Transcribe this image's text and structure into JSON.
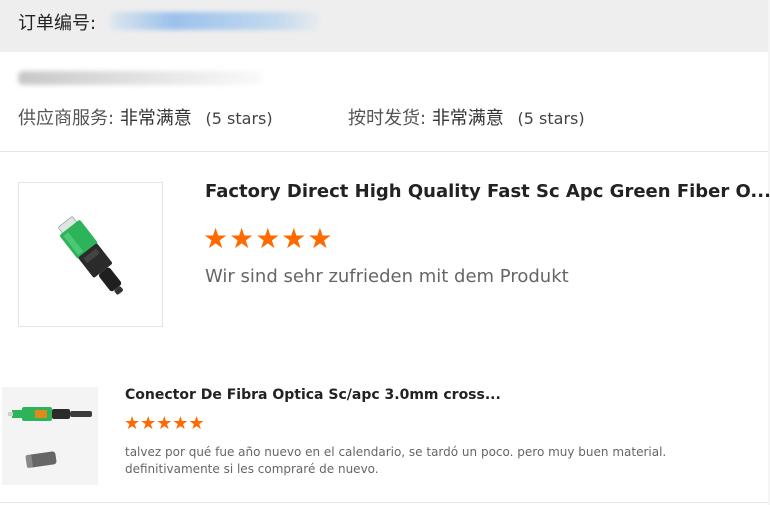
{
  "order": {
    "label": "订单编号:",
    "number_masked": true
  },
  "buyer": {
    "name_masked": true
  },
  "store_ratings": [
    {
      "label": "供应商服务:",
      "value": "非常满意",
      "stars": "(5 stars)"
    },
    {
      "label": "按时发货:",
      "value": "非常满意",
      "stars": "(5 stars)"
    }
  ],
  "reviews": [
    {
      "title": "Factory Direct High Quality Fast Sc Apc Green Fiber O...",
      "rating": 5,
      "stars_glyph": "★★★★★",
      "text": "Wir sind sehr zufrieden mit dem Produkt",
      "image_icon": "green-sc-apc-fast-connector"
    },
    {
      "title": "Conector De Fibra Optica Sc/apc 3.0mm cross...",
      "rating": 5,
      "stars_glyph": "★★★★★",
      "text": "talvez por qué fue año nuevo en el calendario, se tardó un poco. pero muy buen material. definitivamente si les compraré de nuevo.",
      "image_icon": "sc-apc-connector-with-cap"
    }
  ],
  "colors": {
    "star": "#ff6a00",
    "header_bg": "#eeeeee",
    "connector_green": "#2db45a"
  }
}
